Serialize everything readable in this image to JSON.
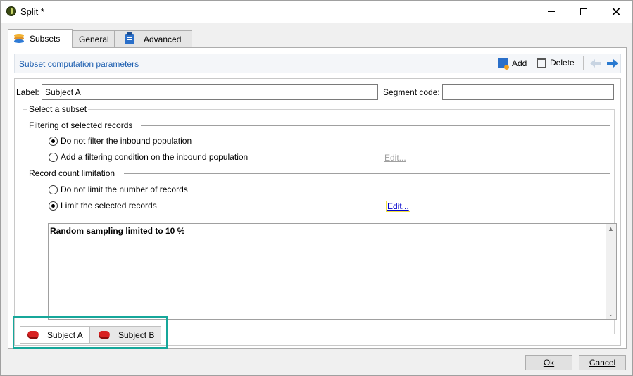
{
  "window": {
    "title": "Split *"
  },
  "tabs": [
    {
      "label": "Subsets",
      "icon": "database-icon"
    },
    {
      "label": "General"
    },
    {
      "label": "Advanced",
      "icon": "clipboard-icon"
    }
  ],
  "toolbar": {
    "title": "Subset computation parameters",
    "add_label": "Add",
    "delete_label": "Delete"
  },
  "form": {
    "label_caption": "Label:",
    "label_value": "Subject A",
    "segment_caption": "Segment code:",
    "segment_value": ""
  },
  "select_subset": {
    "legend": "Select a subset",
    "filtering": {
      "title": "Filtering of selected records",
      "option_no_filter": "Do not filter the inbound population",
      "option_add_filter": "Add a filtering condition on the inbound population",
      "edit_label": "Edit..."
    },
    "limitation": {
      "title": "Record count limitation",
      "option_no_limit": "Do not limit the number of records",
      "option_limit": "Limit the selected records",
      "edit_label": "Edit..."
    },
    "summary": "Random sampling limited to 10 %"
  },
  "subset_tabs": [
    {
      "label": "Subject A"
    },
    {
      "label": "Subject B"
    }
  ],
  "buttons": {
    "ok": "Ok",
    "cancel": "Cancel"
  },
  "colors": {
    "accent": "#1e5fb0",
    "highlight_frame": "#16a79a",
    "segment_icon": "#d82020"
  }
}
